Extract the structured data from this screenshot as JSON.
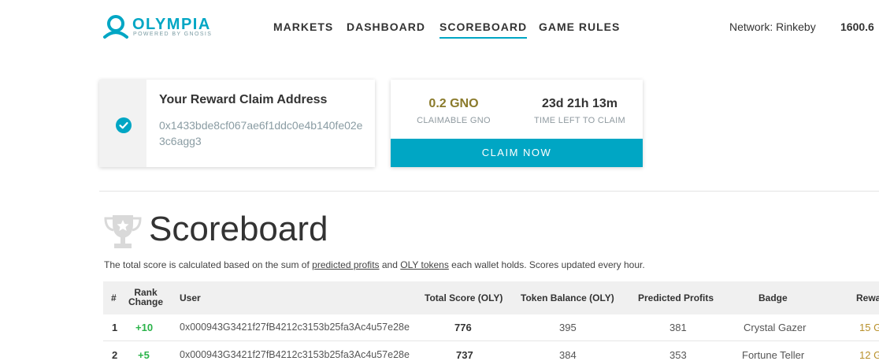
{
  "brand": {
    "name": "OLYMPIA",
    "tagline": "POWERED BY GNOSIS",
    "color": "#00a6c4"
  },
  "nav": {
    "items": [
      {
        "label": "MARKETS",
        "active": false
      },
      {
        "label": "DASHBOARD",
        "active": false
      },
      {
        "label": "SCOREBOARD",
        "active": true
      },
      {
        "label": "GAME RULES",
        "active": false
      }
    ],
    "network": "Network: Rinkeby",
    "balance": "1600.6"
  },
  "reward_address": {
    "title": "Your Reward Claim Address",
    "address": "0x1433bde8cf067ae6f1ddc0e4b140fe02e3c6agg3",
    "icon": "check-circle-icon"
  },
  "claim": {
    "amount": "0.2 GNO",
    "amount_label": "CLAIMABLE GNO",
    "time_left": "23d 21h 13m",
    "time_label": "TIME LEFT TO CLAIM",
    "button_label": "CLAIM NOW",
    "amount_color": "#8a7a2b"
  },
  "scoreboard": {
    "title": "Scoreboard",
    "icon": "trophy-icon",
    "desc_before": "The total score is calculated based on the sum of ",
    "desc_link1": "predicted profits",
    "desc_mid": " and ",
    "desc_link2": "OLY tokens",
    "desc_after": " each wallet holds. Scores updated every hour."
  },
  "table": {
    "headers": {
      "rank": "#",
      "rank_change_1": "Rank",
      "rank_change_2": "Change",
      "user": "User",
      "total_score": "Total Score (OLY)",
      "token_balance": "Token Balance (OLY)",
      "predicted_profits": "Predicted Profits",
      "badge": "Badge",
      "reward": "Rewa"
    },
    "rows": [
      {
        "rank": "1",
        "change": "+10",
        "user": "0x000943G3421f27fB4212c3153b25fa3Ac4u57e28e",
        "total_score": "776",
        "token_balance": "395",
        "predicted_profits": "381",
        "badge": "Crystal Gazer",
        "reward": "15 G"
      },
      {
        "rank": "2",
        "change": "+5",
        "user": "0x000943G3421f27fB4212c3153b25fa3Ac4u57e28e",
        "total_score": "737",
        "token_balance": "384",
        "predicted_profits": "353",
        "badge": "Fortune Teller",
        "reward": "12 G"
      }
    ]
  }
}
